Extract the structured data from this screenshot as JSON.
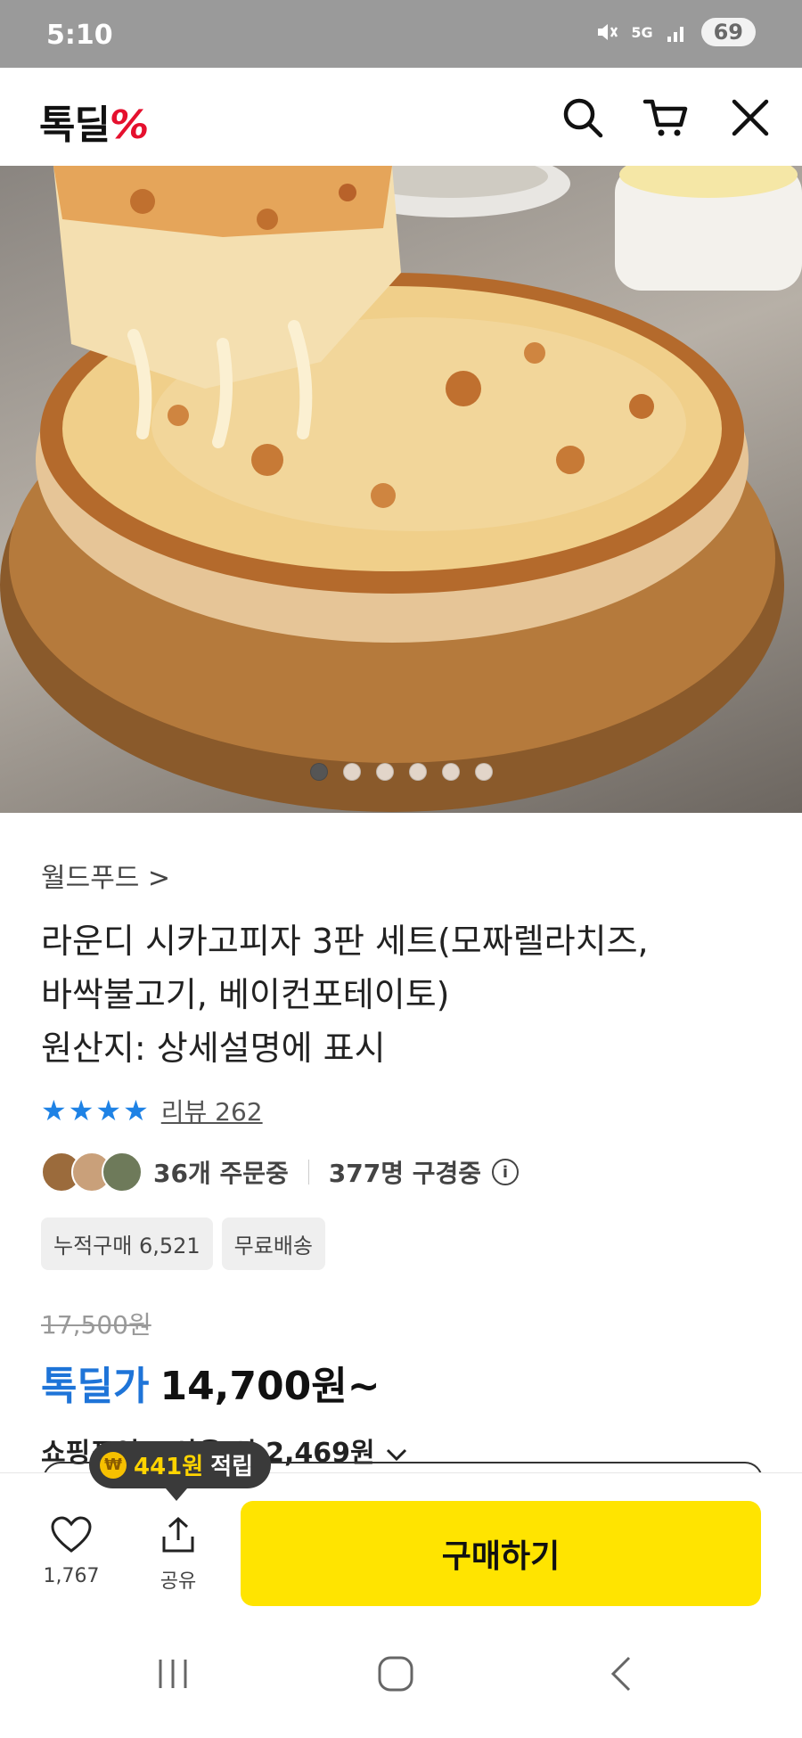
{
  "status_bar": {
    "time": "5:10",
    "battery": "69"
  },
  "header": {
    "logo_text": "톡딜",
    "logo_mark": "%"
  },
  "hero": {
    "total_slides": 6,
    "active_index": 0
  },
  "product": {
    "brand": "월드푸드 >",
    "title_line1": "라운디 시카고피자 3판 세트(모짜렐라치즈,",
    "title_line2": "바싹불고기, 베이컨포테이토)",
    "origin": "원산지: 상세설명에 표시",
    "rating_stars": "★★★★",
    "review_text": "리뷰 262",
    "orders_text": "36개 주문중",
    "viewers_text": "377명 구경중",
    "chips": [
      "누적구매 6,521",
      "무료배송"
    ],
    "original_price": "17,500원",
    "deal_label": "톡딜가",
    "deal_price": "14,700원~",
    "point_text": "쇼핑포인트 사용 시 2,469원"
  },
  "bottom_bar": {
    "tooltip_amount": "441원",
    "tooltip_suffix": "적립",
    "like_count": "1,767",
    "share_label": "공유",
    "buy_label": "구매하기"
  },
  "colors": {
    "accent_blue": "#1e74d8",
    "buy_yellow": "#ffe400",
    "logo_red": "#e5102e"
  }
}
